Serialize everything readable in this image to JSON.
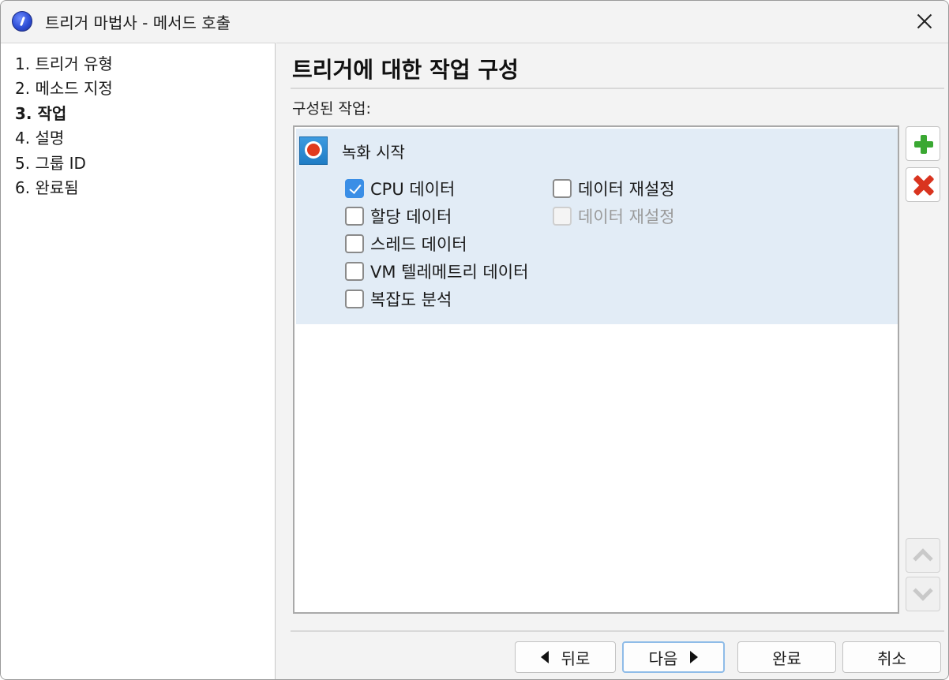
{
  "window": {
    "title": "트리거 마법사 - 메서드 호출"
  },
  "sidebar": {
    "steps": [
      {
        "label": "1. 트리거 유형"
      },
      {
        "label": "2. 메소드 지정"
      },
      {
        "label": "3. 작업",
        "active": true
      },
      {
        "label": "4. 설명"
      },
      {
        "label": "5. 그룹 ID"
      },
      {
        "label": "6. 완료됨"
      }
    ]
  },
  "main": {
    "heading": "트리거에 대한 작업 구성",
    "list_label": "구성된 작업:",
    "actions": [
      {
        "title": "녹화 시작",
        "options": [
          {
            "label": "CPU 데이터",
            "checked": true,
            "enabled": true
          },
          {
            "label": "할당 데이터",
            "checked": false,
            "enabled": true
          },
          {
            "label": "스레드 데이터",
            "checked": false,
            "enabled": true
          },
          {
            "label": "VM 텔레메트리 데이터",
            "checked": false,
            "enabled": true
          },
          {
            "label": "복잡도 분석",
            "checked": false,
            "enabled": true
          },
          {
            "label": "데이터 재설정",
            "checked": false,
            "enabled": true
          },
          {
            "label": "데이터 재설정",
            "checked": false,
            "enabled": false
          }
        ]
      }
    ]
  },
  "side_buttons": {
    "add": "plus-icon",
    "remove": "x-icon",
    "up": "chevron-up-icon",
    "down": "chevron-down-icon"
  },
  "footer": {
    "back_label": "뒤로",
    "next_label": "다음",
    "finish_label": "완료",
    "cancel_label": "취소"
  },
  "colors": {
    "selection": "#e2ecf6",
    "checkbox_checked": "#3a8ee6",
    "add": "#3aa832",
    "remove": "#d9341f",
    "record": "#e03a1e"
  }
}
